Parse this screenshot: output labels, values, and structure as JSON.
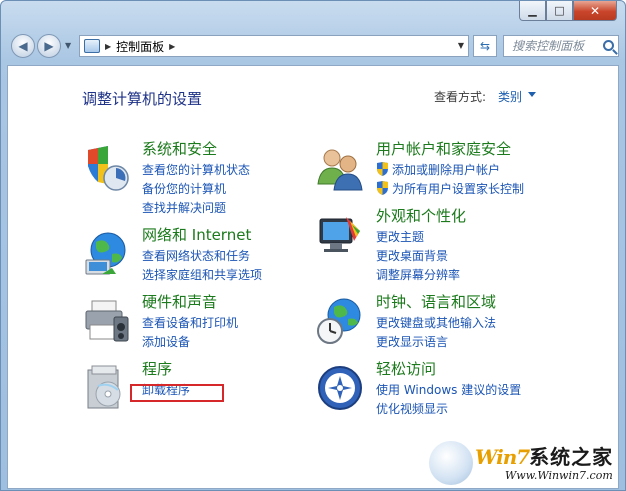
{
  "window": {
    "minimize_label": "▁",
    "maximize_label": "□",
    "close_label": "✕"
  },
  "nav": {
    "address_path": "控制面板",
    "search_placeholder": "搜索控制面板"
  },
  "page": {
    "title": "调整计算机的设置",
    "view_by_label": "查看方式:",
    "view_by_value": "类别"
  },
  "categories": {
    "system": {
      "title": "系统和安全",
      "links": [
        "查看您的计算机状态",
        "备份您的计算机",
        "查找并解决问题"
      ]
    },
    "network": {
      "title": "网络和 Internet",
      "links": [
        "查看网络状态和任务",
        "选择家庭组和共享选项"
      ]
    },
    "hardware": {
      "title": "硬件和声音",
      "links": [
        "查看设备和打印机",
        "添加设备"
      ]
    },
    "programs": {
      "title": "程序",
      "links": [
        "卸载程序"
      ]
    },
    "users": {
      "title": "用户帐户和家庭安全",
      "links": [
        "添加或删除用户帐户",
        "为所有用户设置家长控制"
      ]
    },
    "appearance": {
      "title": "外观和个性化",
      "links": [
        "更改主题",
        "更改桌面背景",
        "调整屏幕分辨率"
      ]
    },
    "clock": {
      "title": "时钟、语言和区域",
      "links": [
        "更改键盘或其他输入法",
        "更改显示语言"
      ]
    },
    "ease": {
      "title": "轻松访问",
      "links": [
        "使用 Windows 建议的设置",
        "优化视频显示"
      ]
    }
  },
  "watermark": {
    "brand_win": "Win7",
    "brand_cn": "系统之家",
    "url": "Www.Winwin7.com"
  }
}
